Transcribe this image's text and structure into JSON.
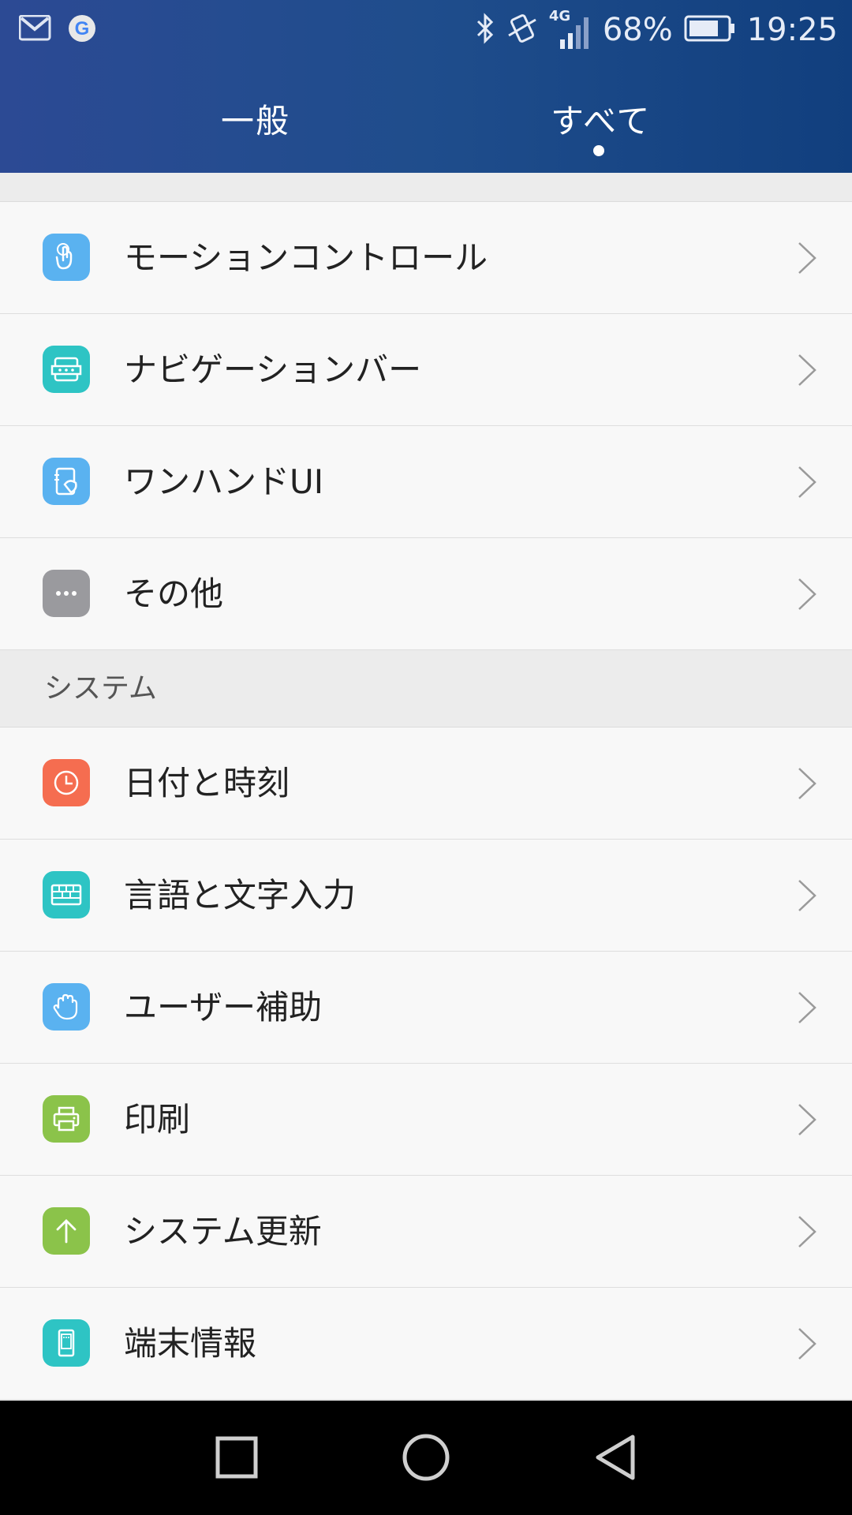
{
  "status_bar": {
    "left_icons": [
      "gmail-icon",
      "google-icon"
    ],
    "right_icons": [
      "bluetooth-icon",
      "vibrate-icon",
      "signal-icon",
      "battery-icon"
    ],
    "network": "4G",
    "battery": "68%",
    "time": "19:25"
  },
  "tabs": {
    "general": "一般",
    "all": "すべて"
  },
  "colors": {
    "header_start": "#2c4a94",
    "header_end": "#113f7e",
    "blue_icon": "#5ab2f0",
    "teal_icon": "#2ec4c4",
    "gray_icon": "#9a9a9e",
    "orange_icon": "#f56d50",
    "green_icon": "#8bc34a"
  },
  "items_top": [
    {
      "label": "モーションコントロール",
      "icon": "motion-icon"
    },
    {
      "label": "ナビゲーションバー",
      "icon": "navbar-icon"
    },
    {
      "label": "ワンハンドUI",
      "icon": "one-hand-icon"
    },
    {
      "label": "その他",
      "icon": "more-icon"
    }
  ],
  "section_system": "システム",
  "items_system": [
    {
      "label": "日付と時刻",
      "icon": "clock-icon"
    },
    {
      "label": "言語と文字入力",
      "icon": "keyboard-icon"
    },
    {
      "label": "ユーザー補助",
      "icon": "hand-icon"
    },
    {
      "label": "印刷",
      "icon": "printer-icon"
    },
    {
      "label": "システム更新",
      "icon": "update-arrow-icon"
    },
    {
      "label": "端末情報",
      "icon": "phone-info-icon"
    }
  ],
  "nav": [
    "recents-icon",
    "home-icon",
    "back-icon"
  ]
}
